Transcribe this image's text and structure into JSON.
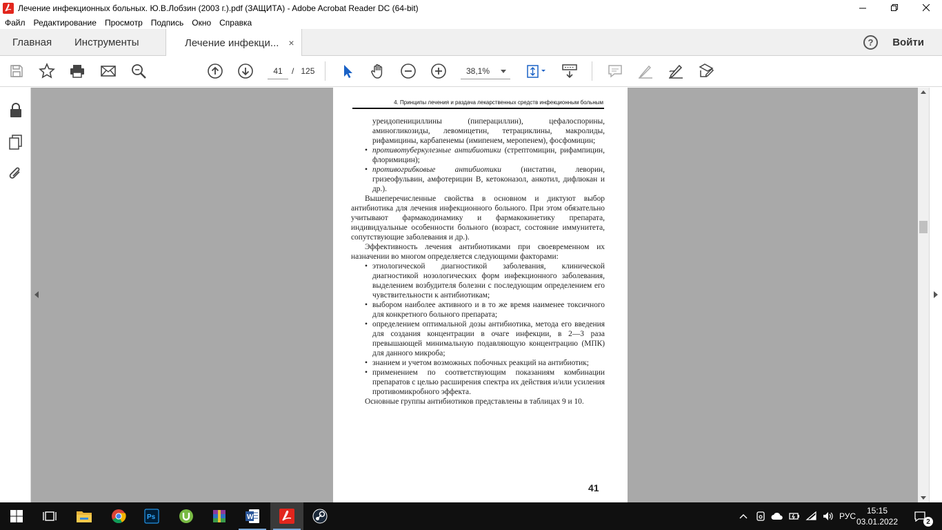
{
  "window": {
    "title": "Лечение инфекционных больных. Ю.В.Лобзин (2003 г.).pdf (ЗАЩИТА) - Adobe Acrobat Reader DC (64-bit)"
  },
  "menu": [
    "Файл",
    "Редактирование",
    "Просмотр",
    "Подпись",
    "Окно",
    "Справка"
  ],
  "tabs": {
    "home": "Главная",
    "tools": "Инструменты",
    "document": "Лечение инфекци...",
    "close": "×",
    "help": "?",
    "sign_in": "Войти"
  },
  "toolbar": {
    "current_page": "41",
    "page_separator": "/",
    "total_pages": "125",
    "zoom": "38,1%"
  },
  "document": {
    "running_head": "4. Принципы лечения и раздача лекарственных средств инфекционным больным",
    "page_number": "41",
    "paragraphs": [
      {
        "kind": "cont",
        "text": "уреидопенициллины (пиперациллин), цефалоспорины, аминогликозиды, левомицетин, тетрациклины, макролиды, рифамицины, карбапенемы (имипенем, меропенем), фосфомицин;"
      },
      {
        "kind": "bullet",
        "lead": "противотуберкулезные антибиотики",
        "text": " (стрептомицин, рифампицин, флоримицин);"
      },
      {
        "kind": "bullet",
        "lead": "противогрибковые антибиотики",
        "text": " (нистатин, леворин, гризеофульвин, амфотерицин В, кетоконазол, анкотил, дифлюкан и др.)."
      },
      {
        "kind": "indent",
        "text": "Вышеперечисленные свойства в основном и диктуют выбор антибиотика для лечения инфекционного больного. При этом обязательно учитывают фармакодинамику и фармакокинетику препарата, индивидуальные особенности больного (возраст, состояние иммунитета, сопутствующие заболевания и др.)."
      },
      {
        "kind": "indent",
        "text": "Эффективность лечения антибиотиками при своевременном их назначении во многом определяется следующими факторами:"
      },
      {
        "kind": "bullet",
        "lead": "",
        "text": "этиологической диагностикой заболевания, клинической диагностикой нозологических форм инфекционного заболевания, выделением возбудителя болезни с последующим определением его чувствительности к антибиотикам;"
      },
      {
        "kind": "bullet",
        "lead": "",
        "text": "выбором наиболее активного и в то же время наименее токсичного для конкретного больного препарата;"
      },
      {
        "kind": "bullet",
        "lead": "",
        "text": "определением оптимальной дозы антибиотика, метода его введения для создания концентрации в очаге инфекции, в 2—3 раза превышающей минимальную подавляющую концентрацию (МПК) для данного микроба;"
      },
      {
        "kind": "bullet",
        "lead": "",
        "text": "знанием и учетом возможных побочных реакций на антибиотик;"
      },
      {
        "kind": "bullet",
        "lead": "",
        "text": "применением по соответствующим показаниям комбинации препаратов с целью расширения спектра их действия и/или усиления противомикробного эффекта."
      },
      {
        "kind": "indent",
        "text": "Основные группы антибиотиков представлены в таблицах 9 и 10."
      }
    ]
  },
  "taskbar": {
    "apps": [
      "start-icon",
      "task-view-icon",
      "file-explorer-icon",
      "chrome-icon",
      "photoshop-icon",
      "utorrent-icon",
      "winrar-icon",
      "word-icon",
      "acrobat-icon",
      "steam-icon"
    ],
    "language": "РУС",
    "time": "15:15",
    "date": "03.01.2022",
    "notifications": "2"
  },
  "colors": {
    "acrobat_red": "#e2261d",
    "doc_background": "#a9a9a9",
    "taskbar": "#101010"
  }
}
